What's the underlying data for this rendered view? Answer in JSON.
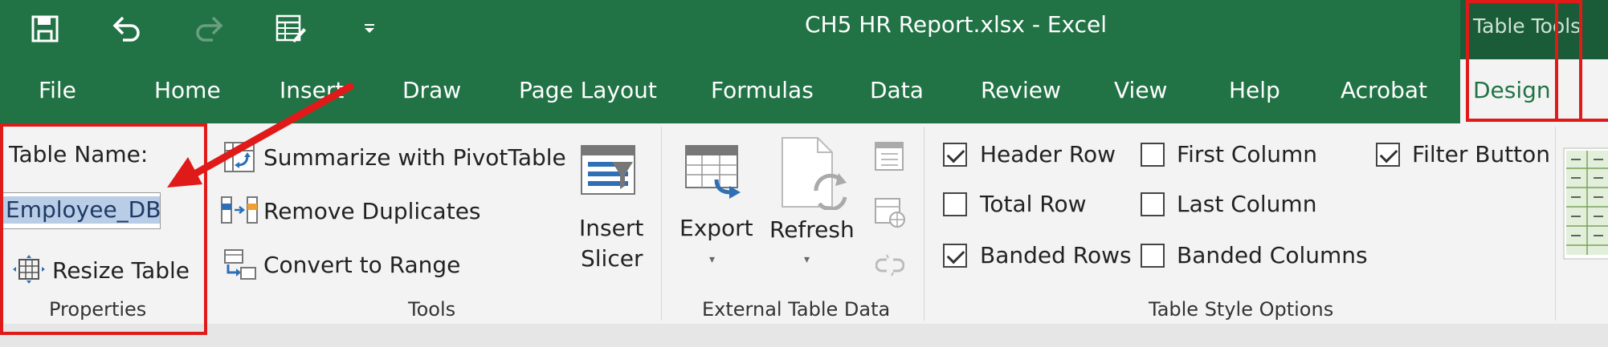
{
  "window": {
    "title": "CH5 HR Report.xlsx  -  Excel",
    "context_title": "Table Tools"
  },
  "colors": {
    "excel_green": "#217346",
    "annotation_red": "#e01919"
  },
  "quick_access": [
    "save-icon",
    "undo-icon",
    "redo-icon",
    "form-icon",
    "customize-dropdown-icon"
  ],
  "tabs": [
    {
      "label": "File"
    },
    {
      "label": "Home"
    },
    {
      "label": "Insert"
    },
    {
      "label": "Draw"
    },
    {
      "label": "Page Layout"
    },
    {
      "label": "Formulas"
    },
    {
      "label": "Data"
    },
    {
      "label": "Review"
    },
    {
      "label": "View"
    },
    {
      "label": "Help"
    },
    {
      "label": "Acrobat"
    },
    {
      "label": "Design"
    }
  ],
  "properties": {
    "table_name_label": "Table Name:",
    "table_name_value": "Employee_DB",
    "resize_label": "Resize Table",
    "group_label": "Properties"
  },
  "tools": {
    "summarize_label": "Summarize with PivotTable",
    "remove_duplicates_label": "Remove Duplicates",
    "convert_label": "Convert to Range",
    "insert_slicer_line1": "Insert",
    "insert_slicer_line2": "Slicer",
    "group_label": "Tools"
  },
  "external": {
    "export_label": "Export",
    "refresh_label": "Refresh",
    "group_label": "External Table Data"
  },
  "style_options": {
    "header_row": {
      "label": "Header Row",
      "checked": true
    },
    "total_row": {
      "label": "Total Row",
      "checked": false
    },
    "banded_rows": {
      "label": "Banded Rows",
      "checked": true
    },
    "first_column": {
      "label": "First Column",
      "checked": false
    },
    "last_column": {
      "label": "Last Column",
      "checked": false
    },
    "banded_columns": {
      "label": "Banded Columns",
      "checked": false
    },
    "filter_button": {
      "label": "Filter Button",
      "checked": true
    },
    "group_label": "Table Style Options"
  }
}
